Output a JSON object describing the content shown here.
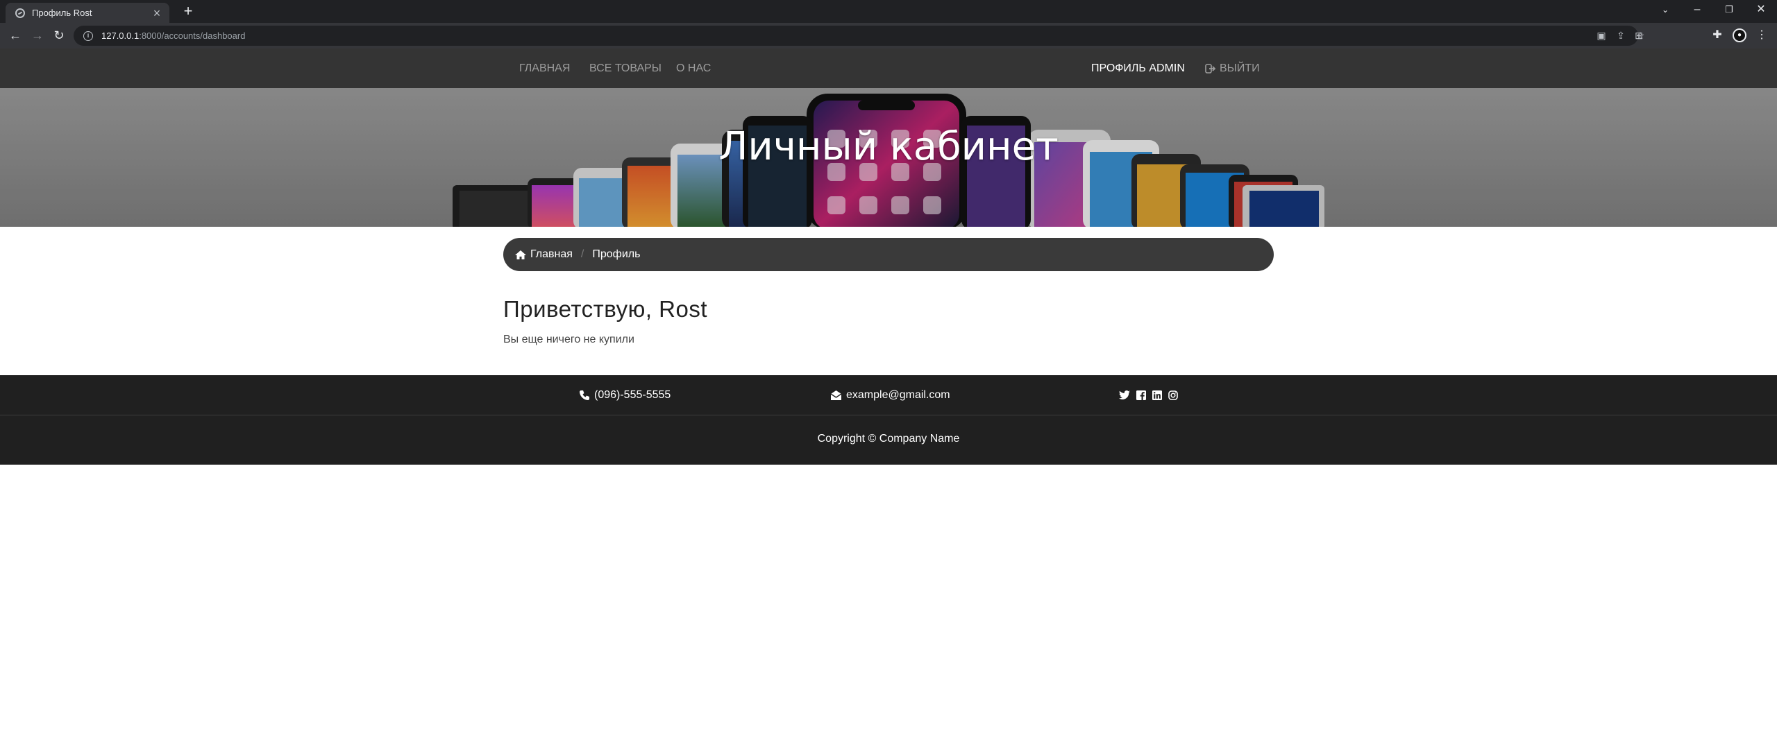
{
  "browser": {
    "tab_title": "Профиль Rost",
    "url_host": "127.0.0.1",
    "url_rest": ":8000/accounts/dashboard"
  },
  "navbar": {
    "home": "ГЛАВНАЯ",
    "all_products": "ВСЕ ТОВАРЫ",
    "about": "О НАС",
    "profile": "ПРОФИЛЬ ADMIN",
    "logout": "ВЫЙТИ"
  },
  "hero": {
    "title": "Личный кабинет"
  },
  "breadcrumb": {
    "home": "Главная",
    "current": "Профиль"
  },
  "main": {
    "greeting": "Приветствую, Rost",
    "empty_note": "Вы еще ничего не купили"
  },
  "footer": {
    "phone": "(096)-555-5555",
    "email": "example@gmail.com",
    "social_icons": [
      "twitter-icon",
      "facebook-icon",
      "linkedin-icon",
      "instagram-icon"
    ],
    "copyright": "Copyright © Company Name"
  },
  "colors": {
    "navbar_bg": "#343434",
    "footer_bg": "#202020",
    "breadcrumb_bg": "#3a3a3a",
    "browser_bg": "#202124"
  }
}
